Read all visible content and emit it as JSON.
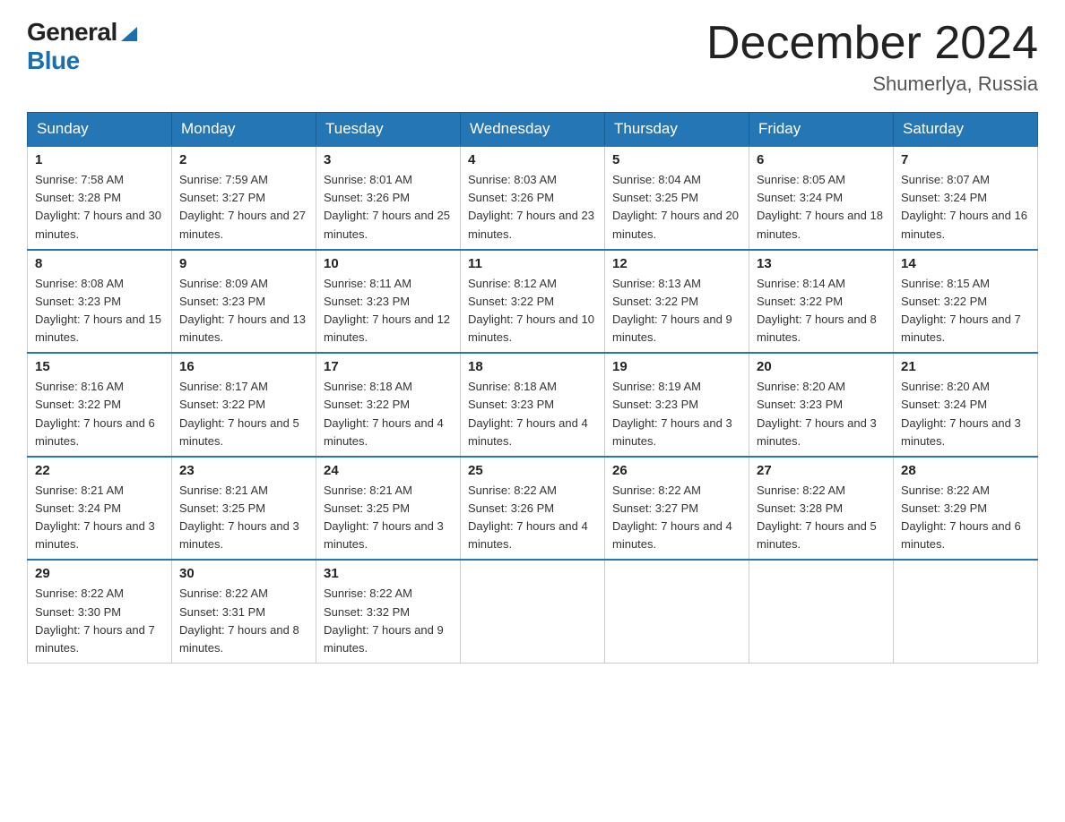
{
  "logo": {
    "general": "General",
    "blue": "Blue"
  },
  "title": "December 2024",
  "location": "Shumerlya, Russia",
  "days_of_week": [
    "Sunday",
    "Monday",
    "Tuesday",
    "Wednesday",
    "Thursday",
    "Friday",
    "Saturday"
  ],
  "weeks": [
    [
      {
        "day": "1",
        "sunrise": "7:58 AM",
        "sunset": "3:28 PM",
        "daylight": "7 hours and 30 minutes."
      },
      {
        "day": "2",
        "sunrise": "7:59 AM",
        "sunset": "3:27 PM",
        "daylight": "7 hours and 27 minutes."
      },
      {
        "day": "3",
        "sunrise": "8:01 AM",
        "sunset": "3:26 PM",
        "daylight": "7 hours and 25 minutes."
      },
      {
        "day": "4",
        "sunrise": "8:03 AM",
        "sunset": "3:26 PM",
        "daylight": "7 hours and 23 minutes."
      },
      {
        "day": "5",
        "sunrise": "8:04 AM",
        "sunset": "3:25 PM",
        "daylight": "7 hours and 20 minutes."
      },
      {
        "day": "6",
        "sunrise": "8:05 AM",
        "sunset": "3:24 PM",
        "daylight": "7 hours and 18 minutes."
      },
      {
        "day": "7",
        "sunrise": "8:07 AM",
        "sunset": "3:24 PM",
        "daylight": "7 hours and 16 minutes."
      }
    ],
    [
      {
        "day": "8",
        "sunrise": "8:08 AM",
        "sunset": "3:23 PM",
        "daylight": "7 hours and 15 minutes."
      },
      {
        "day": "9",
        "sunrise": "8:09 AM",
        "sunset": "3:23 PM",
        "daylight": "7 hours and 13 minutes."
      },
      {
        "day": "10",
        "sunrise": "8:11 AM",
        "sunset": "3:23 PM",
        "daylight": "7 hours and 12 minutes."
      },
      {
        "day": "11",
        "sunrise": "8:12 AM",
        "sunset": "3:22 PM",
        "daylight": "7 hours and 10 minutes."
      },
      {
        "day": "12",
        "sunrise": "8:13 AM",
        "sunset": "3:22 PM",
        "daylight": "7 hours and 9 minutes."
      },
      {
        "day": "13",
        "sunrise": "8:14 AM",
        "sunset": "3:22 PM",
        "daylight": "7 hours and 8 minutes."
      },
      {
        "day": "14",
        "sunrise": "8:15 AM",
        "sunset": "3:22 PM",
        "daylight": "7 hours and 7 minutes."
      }
    ],
    [
      {
        "day": "15",
        "sunrise": "8:16 AM",
        "sunset": "3:22 PM",
        "daylight": "7 hours and 6 minutes."
      },
      {
        "day": "16",
        "sunrise": "8:17 AM",
        "sunset": "3:22 PM",
        "daylight": "7 hours and 5 minutes."
      },
      {
        "day": "17",
        "sunrise": "8:18 AM",
        "sunset": "3:22 PM",
        "daylight": "7 hours and 4 minutes."
      },
      {
        "day": "18",
        "sunrise": "8:18 AM",
        "sunset": "3:23 PM",
        "daylight": "7 hours and 4 minutes."
      },
      {
        "day": "19",
        "sunrise": "8:19 AM",
        "sunset": "3:23 PM",
        "daylight": "7 hours and 3 minutes."
      },
      {
        "day": "20",
        "sunrise": "8:20 AM",
        "sunset": "3:23 PM",
        "daylight": "7 hours and 3 minutes."
      },
      {
        "day": "21",
        "sunrise": "8:20 AM",
        "sunset": "3:24 PM",
        "daylight": "7 hours and 3 minutes."
      }
    ],
    [
      {
        "day": "22",
        "sunrise": "8:21 AM",
        "sunset": "3:24 PM",
        "daylight": "7 hours and 3 minutes."
      },
      {
        "day": "23",
        "sunrise": "8:21 AM",
        "sunset": "3:25 PM",
        "daylight": "7 hours and 3 minutes."
      },
      {
        "day": "24",
        "sunrise": "8:21 AM",
        "sunset": "3:25 PM",
        "daylight": "7 hours and 3 minutes."
      },
      {
        "day": "25",
        "sunrise": "8:22 AM",
        "sunset": "3:26 PM",
        "daylight": "7 hours and 4 minutes."
      },
      {
        "day": "26",
        "sunrise": "8:22 AM",
        "sunset": "3:27 PM",
        "daylight": "7 hours and 4 minutes."
      },
      {
        "day": "27",
        "sunrise": "8:22 AM",
        "sunset": "3:28 PM",
        "daylight": "7 hours and 5 minutes."
      },
      {
        "day": "28",
        "sunrise": "8:22 AM",
        "sunset": "3:29 PM",
        "daylight": "7 hours and 6 minutes."
      }
    ],
    [
      {
        "day": "29",
        "sunrise": "8:22 AM",
        "sunset": "3:30 PM",
        "daylight": "7 hours and 7 minutes."
      },
      {
        "day": "30",
        "sunrise": "8:22 AM",
        "sunset": "3:31 PM",
        "daylight": "7 hours and 8 minutes."
      },
      {
        "day": "31",
        "sunrise": "8:22 AM",
        "sunset": "3:32 PM",
        "daylight": "7 hours and 9 minutes."
      },
      null,
      null,
      null,
      null
    ]
  ]
}
